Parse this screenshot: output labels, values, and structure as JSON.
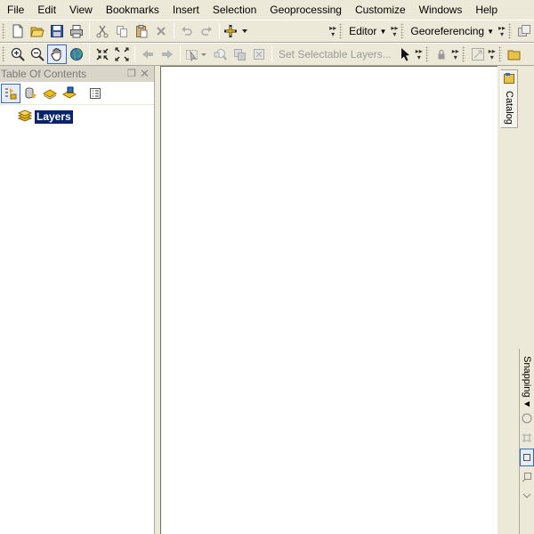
{
  "menu": {
    "items": [
      "File",
      "Edit",
      "View",
      "Bookmarks",
      "Insert",
      "Selection",
      "Geoprocessing",
      "Customize",
      "Windows",
      "Help"
    ]
  },
  "toolbar1": {
    "editor_label": "Editor",
    "georeferencing_label": "Georeferencing"
  },
  "toolbar2": {
    "set_selectable_layers": "Set Selectable Layers..."
  },
  "toc": {
    "title": "Table Of Contents",
    "pin_glyph": "❒",
    "close_glyph": "✕",
    "layers_label": "Layers"
  },
  "dock": {
    "catalog_label": "Catalog",
    "snapping_label": "Snapping"
  },
  "colors": {
    "chrome": "#ECE9D8",
    "selection": "#0A246A",
    "accent": "#316AC5"
  }
}
